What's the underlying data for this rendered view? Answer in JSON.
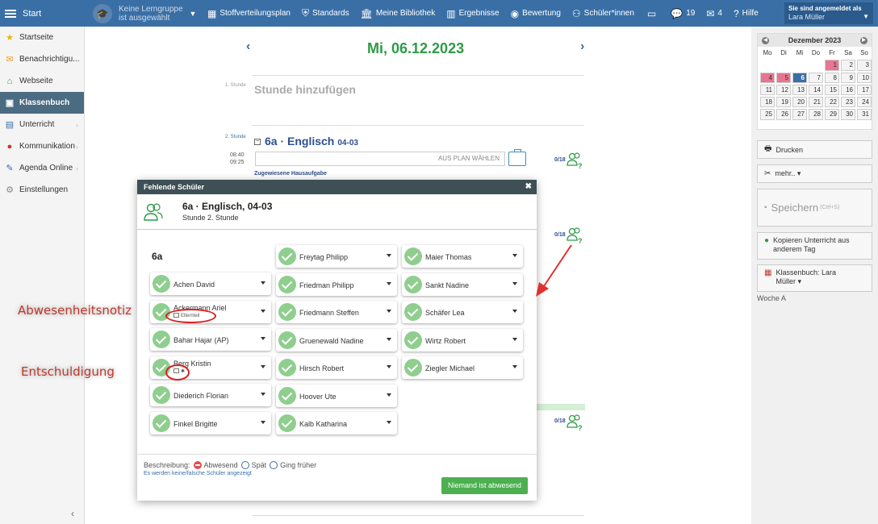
{
  "topbar": {
    "start": "Start",
    "lerngruppe": [
      "Keine Lerngruppe",
      "ist ausgewählt"
    ],
    "nav": [
      {
        "label": "Stoffverteilungsplan",
        "icon": "table-icon"
      },
      {
        "label": "Standards",
        "icon": "shield-icon"
      },
      {
        "label": "Meine Bibliothek",
        "icon": "library-icon"
      },
      {
        "label": "Ergebnisse",
        "icon": "bar-chart-icon"
      },
      {
        "label": "Bewertung",
        "icon": "dashboard-icon"
      },
      {
        "label": "Schüler*innen",
        "icon": "students-icon"
      }
    ],
    "messages_count": "19",
    "mail_count": "4",
    "help": "Hilfe",
    "login_label": "Sie sind angemeldet als",
    "login_user": "Lara Müller"
  },
  "sidebar": {
    "items": [
      {
        "label": "Startseite",
        "icon": "star-icon",
        "color": "#e6b800"
      },
      {
        "label": "Benachrichtigu...",
        "icon": "envelope-icon",
        "color": "#f0a030"
      },
      {
        "label": "Webseite",
        "icon": "home-icon",
        "color": "#2e9a47"
      },
      {
        "label": "Klassenbuch",
        "icon": "book-icon",
        "active": true
      },
      {
        "label": "Unterricht",
        "icon": "monitor-icon",
        "color": "#3a6fa6",
        "chevron": true
      },
      {
        "label": "Kommunikation",
        "icon": "chat-icon",
        "color": "#c0392b",
        "chevron": true
      },
      {
        "label": "Agenda Online",
        "icon": "pen-icon",
        "color": "#3a6fa6",
        "chevron": true
      },
      {
        "label": "Einstellungen",
        "icon": "gear-icon",
        "color": "#888"
      }
    ]
  },
  "main": {
    "date": "Mi, 06.12.2023",
    "lesson1_label": "1. Stunde",
    "add_lesson": "Stunde hinzufügen",
    "lesson2_label": "2. Stunde",
    "lesson2_time_start": "08:40",
    "lesson2_time_end": "09:25",
    "lesson2_title": "6a · Englisch",
    "lesson2_room": "04-03",
    "plan_select": "AUS PLAN WÄHLEN",
    "homework": "Zugewiesene Hausaufgabe",
    "counts": [
      "0/18",
      "0/18",
      "0/18"
    ]
  },
  "calendar": {
    "month": "Dezember 2023",
    "dow": [
      "Mo",
      "Di",
      "Mi",
      "Do",
      "Fr",
      "Sa",
      "So"
    ],
    "weeks": [
      [
        "",
        "",
        "",
        "",
        "1",
        "2",
        "3"
      ],
      [
        "4",
        "5",
        "6",
        "7",
        "8",
        "9",
        "10"
      ],
      [
        "11",
        "12",
        "13",
        "14",
        "15",
        "16",
        "17"
      ],
      [
        "18",
        "19",
        "20",
        "21",
        "22",
        "23",
        "24"
      ],
      [
        "25",
        "26",
        "27",
        "28",
        "29",
        "30",
        "31"
      ]
    ],
    "highlight": [
      "1",
      "4",
      "5"
    ],
    "today": "6"
  },
  "right": {
    "print": "Drucken",
    "more": "mehr.. ▾",
    "save": "Speichern",
    "save_shortcut": "(Ctrl+S)",
    "copy": [
      "Kopieren Unterricht aus",
      "anderem Tag"
    ],
    "classbook": [
      "Klassenbuch: Lara",
      "Müller ▾"
    ],
    "week": "Woche A"
  },
  "modal": {
    "title": "Fehlende Schüler",
    "lesson": "6a · Englisch, 04-03",
    "subtitle": "Stunde 2. Stunde",
    "class": "6a",
    "students_col1": [
      "Achen David",
      "Ackermann Ariel",
      "Bahar Hajar (AP)",
      "Berg Kristin",
      "Diederich Florian",
      "Finkel Brigitte"
    ],
    "students_col2": [
      "Freytag Philipp",
      "Friedman Philipp",
      "Friedmann Steffen",
      "Gruenewald Nadine",
      "Hirsch Robert",
      "Hoover Ute",
      "Kalb Katharina"
    ],
    "students_col3": [
      "Maier Thomas",
      "Sankt Nadine",
      "Schäfer Lea",
      "Wirtz Robert",
      "Ziegler Michael"
    ],
    "note_elternteil": "Elternteil",
    "note_excuse": "✱",
    "legend_label": "Beschreibung:",
    "legend_absent": "Abwesend",
    "legend_late": "Spät",
    "legend_early": "Ging früher",
    "wrong_students": "Es werden keine/falsche Schüler angezeigt",
    "nobody_absent": "Niemand ist abwesend"
  },
  "annotations": {
    "note": "Abwesenheitsnotiz",
    "excuse": "Entschuldigung"
  }
}
